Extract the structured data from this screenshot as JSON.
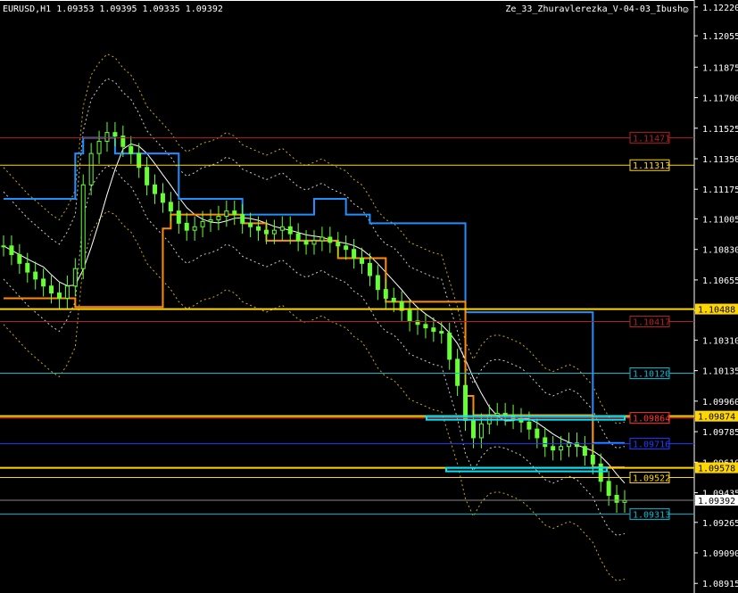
{
  "header": {
    "symbol": "EURUSD,H1",
    "ohlc": "1.09353 1.09395 1.09335 1.09392",
    "indicator": "Ze_33_Zhuravlerezka_V-04-03_Ibush",
    "indicator_icon": "smiley-icon"
  },
  "colors": {
    "background": "#000000",
    "axis": "#ffffff",
    "candle": "#66ff33",
    "blue_line": "#1e90ff",
    "orange_line": "#ff8c00",
    "yellow_line": "#ffd700",
    "cyan_box": "#00e5ff",
    "red_level": "#ff3333"
  },
  "chart_data": {
    "type": "line",
    "symbol": "EURUSD",
    "timeframe": "H1",
    "ylim": [
      1.0886,
      1.1226
    ],
    "price_ticks": [
      "1.12220",
      "1.12055",
      "1.11875",
      "1.11700",
      "1.11525",
      "1.11350",
      "1.11175",
      "1.11005",
      "1.10830",
      "1.10655",
      "1.10480",
      "1.10310",
      "1.10135",
      "1.09960",
      "1.09785",
      "1.09610",
      "1.09435",
      "1.09265",
      "1.09090",
      "1.08915"
    ],
    "levels": [
      {
        "label": "1.11471",
        "value": 1.11471,
        "color": "#b22222",
        "style": "box"
      },
      {
        "label": "1.11313",
        "value": 1.11313,
        "color": "#ffd700",
        "style": "box"
      },
      {
        "label": "1.10488",
        "value": 1.10488,
        "color": "#ffd700",
        "style": "filled"
      },
      {
        "label": "1.10417",
        "value": 1.10417,
        "color": "#b22222",
        "style": "box"
      },
      {
        "label": "1.10120",
        "value": 1.1012,
        "color": "#00bcd4",
        "style": "box"
      },
      {
        "label": "1.09874",
        "value": 1.09874,
        "color": "#ffd700",
        "style": "filled"
      },
      {
        "label": "1.09864",
        "value": 1.09864,
        "color": "#ff3333",
        "style": "box"
      },
      {
        "label": "1.09716",
        "value": 1.09716,
        "color": "#1e3cff",
        "style": "box"
      },
      {
        "label": "1.09578",
        "value": 1.09578,
        "color": "#ffd700",
        "style": "filled"
      },
      {
        "label": "1.09522",
        "value": 1.09522,
        "color": "#ffd700",
        "style": "box"
      },
      {
        "label": "1.09392",
        "value": 1.09392,
        "color": "#ffffff",
        "style": "current"
      },
      {
        "label": "1.09313",
        "value": 1.09313,
        "color": "#00bcd4",
        "style": "box"
      }
    ],
    "close_series": [
      1.1085,
      1.108,
      1.1075,
      1.107,
      1.1066,
      1.1062,
      1.1058,
      1.1055,
      1.1062,
      1.1072,
      1.112,
      1.1138,
      1.1145,
      1.115,
      1.1148,
      1.1142,
      1.1138,
      1.113,
      1.112,
      1.1115,
      1.111,
      1.1105,
      1.1098,
      1.1094,
      1.1096,
      1.1099,
      1.11,
      1.1102,
      1.1105,
      1.1103,
      1.1098,
      1.1096,
      1.1094,
      1.1092,
      1.1094,
      1.1096,
      1.1092,
      1.1088,
      1.1086,
      1.1088,
      1.109,
      1.1087,
      1.1085,
      1.1083,
      1.1078,
      1.1075,
      1.1068,
      1.106,
      1.1055,
      1.1053,
      1.1048,
      1.1042,
      1.104,
      1.1038,
      1.1036,
      1.1035,
      1.102,
      1.1005,
      1.0985,
      1.0975,
      1.0983,
      1.0988,
      1.0989,
      1.0988,
      1.0986,
      1.0984,
      1.098,
      1.0975,
      1.097,
      1.0968,
      1.097,
      1.0972,
      1.097,
      1.0965,
      1.096,
      1.095,
      1.0942,
      1.0938,
      1.0939
    ],
    "series": [
      {
        "color": "#1e90ff",
        "values": [
          1.1112,
          1.1112,
          1.1112,
          1.1112,
          1.1112,
          1.1112,
          1.1112,
          1.1112,
          1.1112,
          1.1138,
          1.1147,
          1.1147,
          1.1147,
          1.1147,
          1.1138,
          1.1138,
          1.1138,
          1.1138,
          1.1138,
          1.1138,
          1.1138,
          1.1138,
          1.1112,
          1.1112,
          1.1112,
          1.1112,
          1.1112,
          1.1112,
          1.1112,
          1.1112,
          1.1103,
          1.1103,
          1.1103,
          1.1103,
          1.1103,
          1.1103,
          1.1103,
          1.1103,
          1.1103,
          1.1112,
          1.1112,
          1.1112,
          1.1112,
          1.1103,
          1.1103,
          1.1103,
          1.1098,
          1.1098,
          1.1098,
          1.1098,
          1.1098,
          1.1098,
          1.1098,
          1.1098,
          1.1098,
          1.1098,
          1.1098,
          1.1098,
          1.1047,
          1.1047,
          1.1047,
          1.1047,
          1.1047,
          1.1047,
          1.1047,
          1.1047,
          1.1047,
          1.1047,
          1.1047,
          1.1047,
          1.1047,
          1.1047,
          1.1047,
          1.1047,
          1.0972,
          1.0972,
          1.0972,
          1.0972,
          1.0972
        ]
      },
      {
        "color": "#ff8c00",
        "values": [
          1.1055,
          1.1055,
          1.1055,
          1.1055,
          1.1055,
          1.1055,
          1.1055,
          1.1055,
          1.1055,
          1.105,
          1.105,
          1.105,
          1.105,
          1.105,
          1.105,
          1.105,
          1.105,
          1.105,
          1.105,
          1.105,
          1.1095,
          1.1103,
          1.1103,
          1.1103,
          1.1103,
          1.1103,
          1.1103,
          1.1103,
          1.1103,
          1.1103,
          1.1098,
          1.1098,
          1.1098,
          1.1088,
          1.1088,
          1.1088,
          1.1088,
          1.1088,
          1.1088,
          1.1088,
          1.1088,
          1.1088,
          1.1078,
          1.1078,
          1.1078,
          1.1078,
          1.1078,
          1.1078,
          1.1053,
          1.1053,
          1.1053,
          1.1053,
          1.1053,
          1.1053,
          1.1053,
          1.1053,
          1.1053,
          1.1053,
          1.0999,
          1.0988,
          1.0988,
          1.0988,
          1.0988,
          1.0988,
          1.0988,
          1.0988,
          1.0988,
          1.0988,
          1.0988,
          1.0988,
          1.0988,
          1.0988,
          1.0988,
          1.0988,
          1.0958,
          1.0958,
          1.0958,
          1.0958,
          1.0958
        ]
      }
    ],
    "grid": false,
    "legend": "none"
  }
}
